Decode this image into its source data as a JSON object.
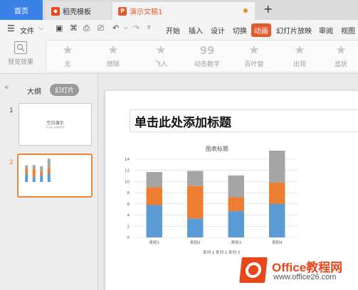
{
  "tabs": {
    "home": "首页",
    "template": "稻壳模板",
    "document": "演示文稿1",
    "new_tab": "+"
  },
  "menu": {
    "file": "文件",
    "items": [
      "开始",
      "插入",
      "设计",
      "切换",
      "动画",
      "幻灯片放映",
      "审阅",
      "视图"
    ],
    "active": "动画"
  },
  "ribbon": {
    "preview": "预览效果",
    "effects": [
      "无",
      "擦除",
      "飞入",
      "动态数字",
      "百叶窗",
      "出现",
      "盒状"
    ]
  },
  "panel": {
    "outline": "大纲",
    "slides": "幻灯片",
    "slide_numbers": [
      "1",
      "2"
    ],
    "thumb1_title": "空白演示",
    "thumb1_sub": "可以输入标题或文字"
  },
  "slide": {
    "title_placeholder": "单击此处添加标题"
  },
  "chart_data": {
    "type": "bar",
    "stacked": true,
    "title": "图表标题",
    "categories": [
      "类别1",
      "类别2",
      "类别3",
      "类别4"
    ],
    "series": [
      {
        "name": "系列 1",
        "values": [
          5.8,
          3.4,
          4.7,
          6.0
        ],
        "color": "#5b9bd5"
      },
      {
        "name": "系列 2",
        "values": [
          3.2,
          5.8,
          2.5,
          3.8
        ],
        "color": "#ed7d31"
      },
      {
        "name": "系列 3",
        "values": [
          2.7,
          2.7,
          3.9,
          6.6
        ],
        "color": "#a5a5a5"
      }
    ],
    "ylim": [
      0,
      14
    ],
    "yticks": [
      0,
      2,
      4,
      6,
      8,
      10,
      12,
      14
    ],
    "grid": true,
    "legend_position": "bottom"
  },
  "watermark": {
    "main": "Office教程网",
    "sub": "www.office26.com"
  }
}
